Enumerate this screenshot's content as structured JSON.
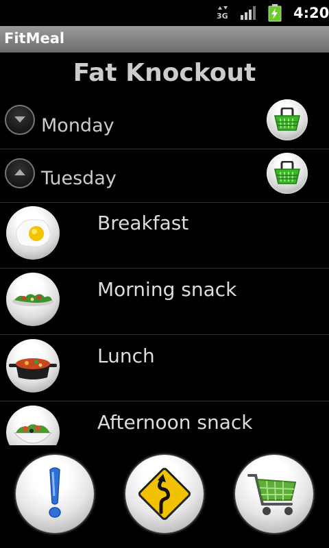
{
  "status_bar": {
    "network": "3G",
    "time": "4:20"
  },
  "app": {
    "title": "FitMeal"
  },
  "plan": {
    "name": "Fat Knockout"
  },
  "days": [
    {
      "label": "Monday",
      "expanded": false
    },
    {
      "label": "Tuesday",
      "expanded": true
    }
  ],
  "meals": [
    {
      "label": "Breakfast",
      "icon": "fried-egg-icon"
    },
    {
      "label": "Morning snack",
      "icon": "salad-icon"
    },
    {
      "label": "Lunch",
      "icon": "pot-icon"
    },
    {
      "label": "Afternoon snack",
      "icon": "salad-bowl-icon"
    }
  ],
  "bottom_bar": {
    "info_icon": "exclamation-icon",
    "route_icon": "winding-road-sign-icon",
    "cart_icon": "shopping-cart-icon"
  },
  "colors": {
    "basket_green": "#3cb528",
    "info_blue": "#2f6fd8",
    "sign_yellow": "#f2c200",
    "cart_green": "#5fae3a"
  }
}
